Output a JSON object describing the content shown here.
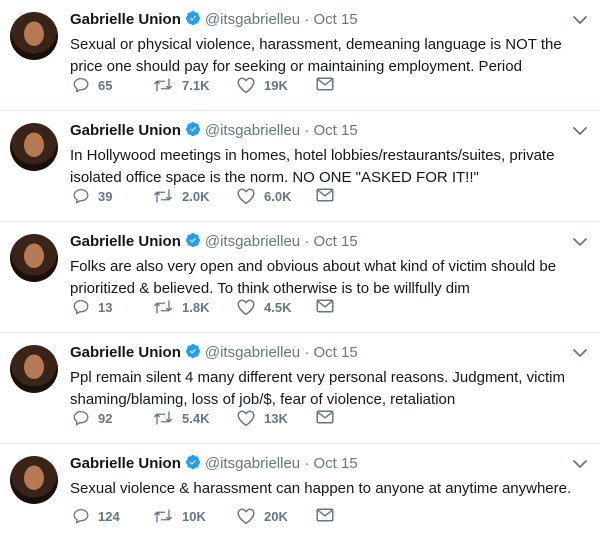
{
  "tweets": [
    {
      "name": "Gabrielle Union",
      "handle": "@itsgabrielleu",
      "dot": "·",
      "date": "Oct 15",
      "text": "Sexual or physical violence, harassment, demeaning language is NOT the price one should pay for seeking or maintaining employment. Period",
      "replies": "65",
      "retweets": "7.1K",
      "likes": "19K"
    },
    {
      "name": "Gabrielle Union",
      "handle": "@itsgabrielleu",
      "dot": "·",
      "date": "Oct 15",
      "text": "In Hollywood meetings in homes, hotel lobbies/restaurants/suites, private isolated office space is the norm. NO ONE \"ASKED FOR IT!!\"",
      "replies": "39",
      "retweets": "2.0K",
      "likes": "6.0K"
    },
    {
      "name": "Gabrielle Union",
      "handle": "@itsgabrielleu",
      "dot": "·",
      "date": "Oct 15",
      "text": "Folks are also very open and obvious about what kind of victim should be prioritized & believed. To think otherwise is to be willfully dim",
      "replies": "13",
      "retweets": "1.8K",
      "likes": "4.5K"
    },
    {
      "name": "Gabrielle Union",
      "handle": "@itsgabrielleu",
      "dot": "·",
      "date": "Oct 15",
      "text": "Ppl remain silent 4 many different very personal reasons. Judgment, victim shaming/blaming, loss of job/$, fear of violence, retaliation",
      "replies": "92",
      "retweets": "5.4K",
      "likes": "13K"
    },
    {
      "name": "Gabrielle Union",
      "handle": "@itsgabrielleu",
      "dot": "·",
      "date": "Oct 15",
      "text": "Sexual violence & harassment can happen to anyone at anytime anywhere.",
      "replies": "124",
      "retweets": "10K",
      "likes": "20K"
    }
  ],
  "colors": {
    "verified": "#1da1f2",
    "muted": "#657786",
    "text": "#14171a"
  },
  "icons": {
    "reply": "reply-icon",
    "retweet": "retweet-icon",
    "like": "heart-icon",
    "dm": "envelope-icon",
    "menu": "chevron-down-icon",
    "verified": "verified-badge-icon"
  }
}
